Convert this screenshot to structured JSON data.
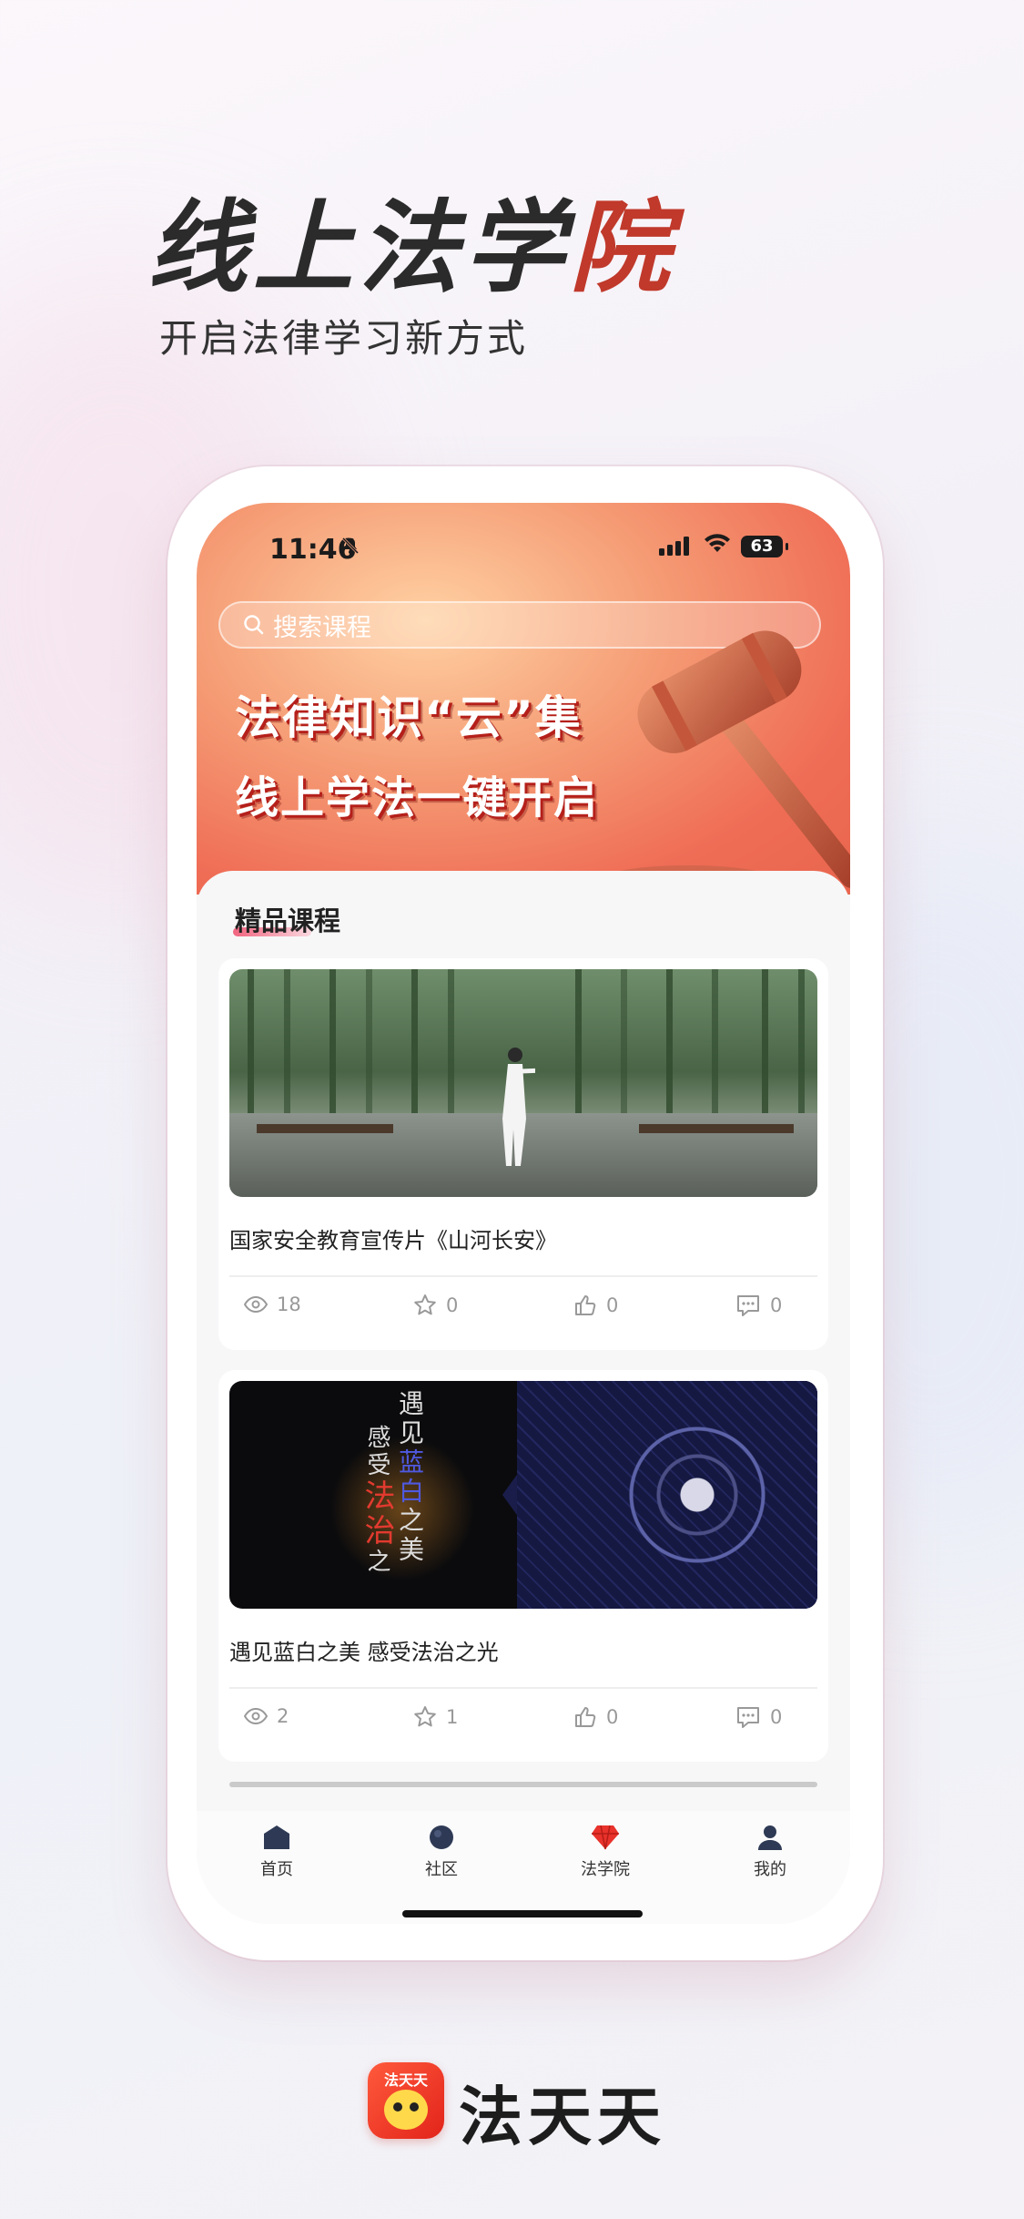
{
  "hero": {
    "title_part1": "线上法学",
    "title_part2": "院",
    "subtitle": "开启法律学习新方式"
  },
  "status_bar": {
    "time": "11:46",
    "battery": "63"
  },
  "search": {
    "placeholder": "搜索课程"
  },
  "banner": {
    "line1": "法律知识“云”集",
    "line2": "线上学法一键开启"
  },
  "section": {
    "title": "精品课程"
  },
  "courses": [
    {
      "title": "国家安全教育宣传片《山河长安》",
      "views": "18",
      "favorites": "0",
      "likes": "0",
      "comments": "0"
    },
    {
      "title": "遇见蓝白之美 感受法治之光",
      "views": "2",
      "favorites": "1",
      "likes": "0",
      "comments": "0",
      "image_text": {
        "col1_a": "遇见",
        "col1_b": "蓝白",
        "col1_c": "之美",
        "col2_a": "感受",
        "col2_b": "法治",
        "col2_c": "之"
      }
    }
  ],
  "tabbar": {
    "items": [
      {
        "label": "首页",
        "icon": "home-icon"
      },
      {
        "label": "社区",
        "icon": "community-icon"
      },
      {
        "label": "法学院",
        "icon": "diamond-icon"
      },
      {
        "label": "我的",
        "icon": "profile-icon"
      }
    ],
    "active_color": "#e8322b"
  },
  "brand": {
    "logo_text": "法天天",
    "name": "法天天"
  }
}
